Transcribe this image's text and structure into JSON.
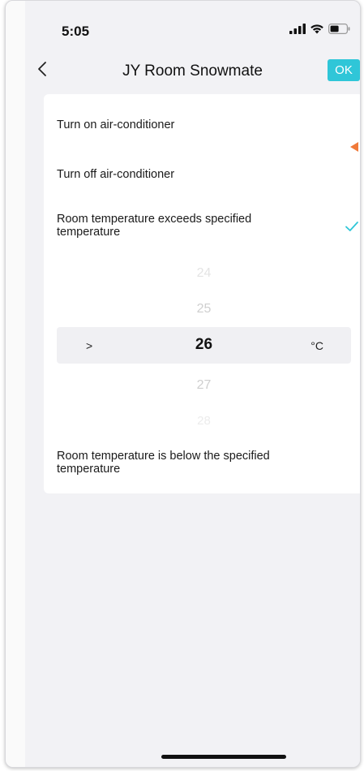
{
  "status_bar": {
    "time": "5:05",
    "icons": [
      "cellular-signal-icon",
      "wifi-icon",
      "battery-icon"
    ]
  },
  "nav": {
    "title": "JY Room Snowmate",
    "ok_label": "OK",
    "accent_color": "#2fc6d8"
  },
  "options": [
    {
      "label": "Turn on air-conditioner",
      "selected": false
    },
    {
      "label": "Turn off air-conditioner",
      "selected": false
    },
    {
      "label": "Room temperature exceeds specified temperature",
      "selected": true
    },
    {
      "label": "Room temperature is below the specified temperature",
      "selected": false
    }
  ],
  "picker": {
    "operator": ">",
    "unit": "°C",
    "values": [
      "24",
      "25",
      "26",
      "27",
      "28"
    ],
    "selected": "26"
  },
  "marker_color": "#f07a3a"
}
